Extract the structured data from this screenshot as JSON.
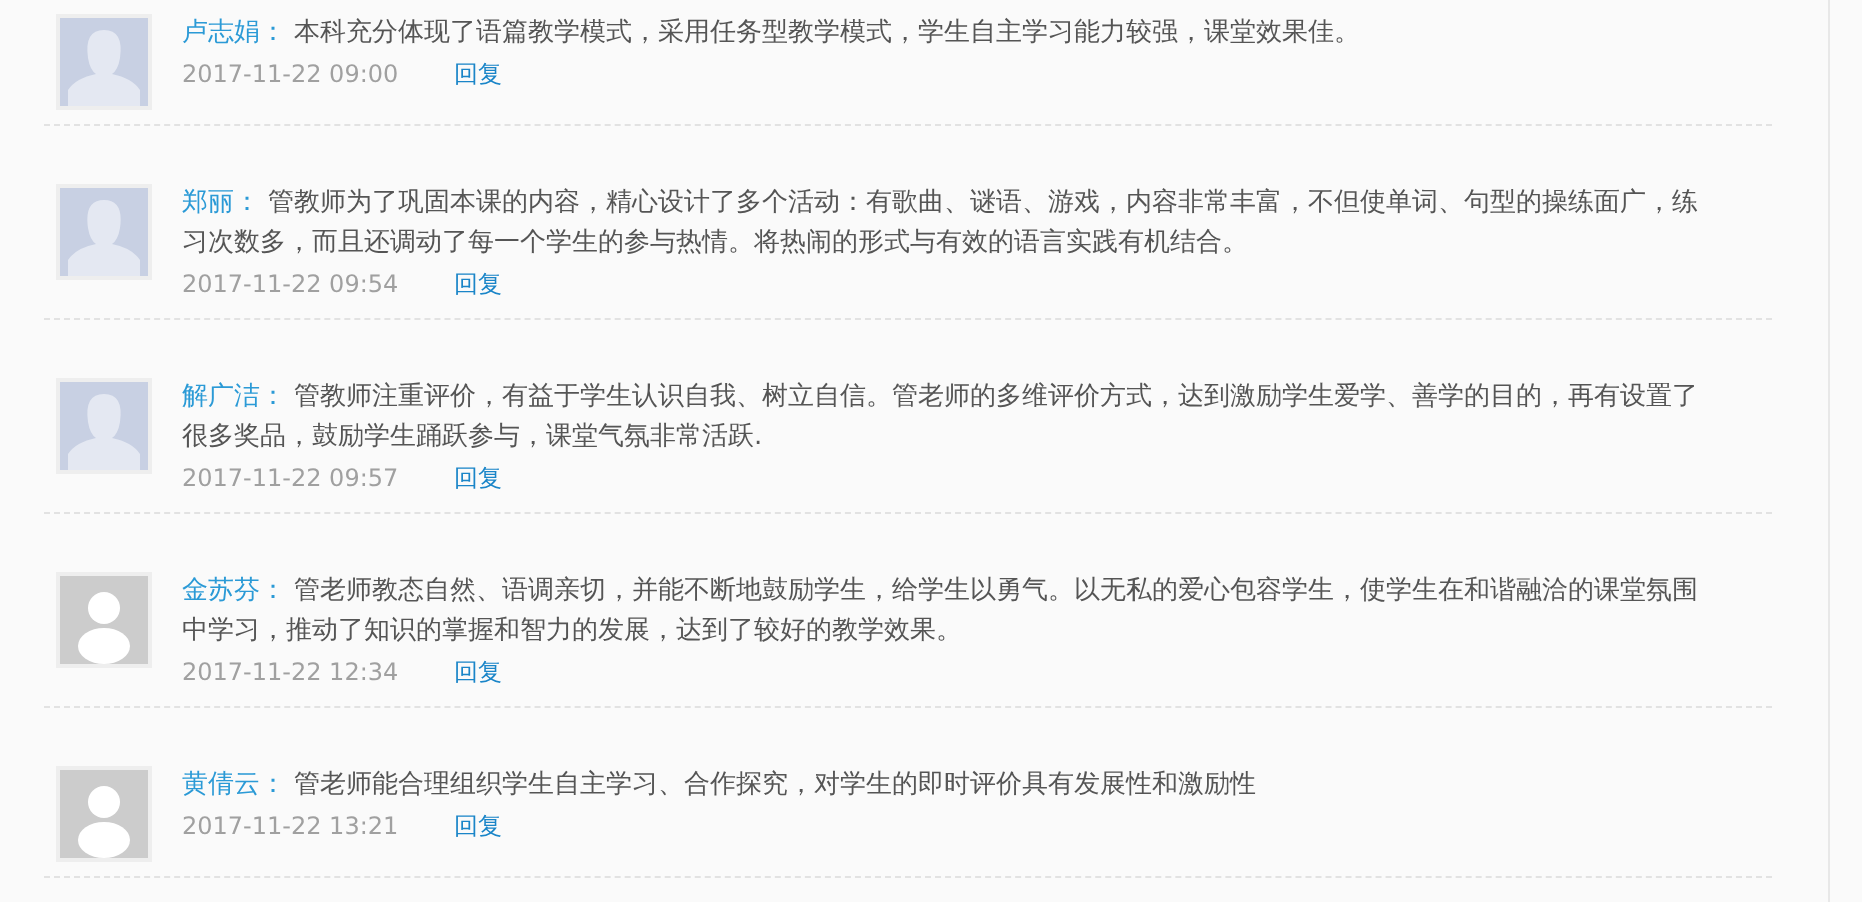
{
  "comments": [
    {
      "kind": "female",
      "author": "卢志娟：",
      "text": "本科充分体现了语篇教学模式，采用任务型教学模式，学生自主学习能力较强，课堂效果佳。",
      "time": "2017-11-22 09:00",
      "reply": "回复"
    },
    {
      "kind": "female",
      "author": "郑丽：",
      "text": "管教师为了巩固本课的内容，精心设计了多个活动：有歌曲、谜语、游戏，内容非常丰富，不但使单词、句型的操练面广，练习次数多，而且还调动了每一个学生的参与热情。将热闹的形式与有效的语言实践有机结合。",
      "time": "2017-11-22 09:54",
      "reply": "回复"
    },
    {
      "kind": "female",
      "author": "解广洁：",
      "text": "管教师注重评价，有益于学生认识自我、树立自信。管老师的多维评价方式，达到激励学生爱学、善学的目的，再有设置了很多奖品，鼓励学生踊跃参与，课堂气氛非常活跃.",
      "time": "2017-11-22 09:57",
      "reply": "回复"
    },
    {
      "kind": "default",
      "author": "金苏芬：",
      "text": "管老师教态自然、语调亲切，并能不断地鼓励学生，给学生以勇气。以无私的爱心包容学生，使学生在和谐融洽的课堂氛围中学习，推动了知识的掌握和智力的发展，达到了较好的教学效果。",
      "time": "2017-11-22 12:34",
      "reply": "回复"
    },
    {
      "kind": "default",
      "author": "黄倩云：",
      "text": "管老师能合理组织学生自主学习、合作探究，对学生的即时评价具有发展性和激励性",
      "time": "2017-11-22 13:21",
      "reply": "回复"
    }
  ]
}
